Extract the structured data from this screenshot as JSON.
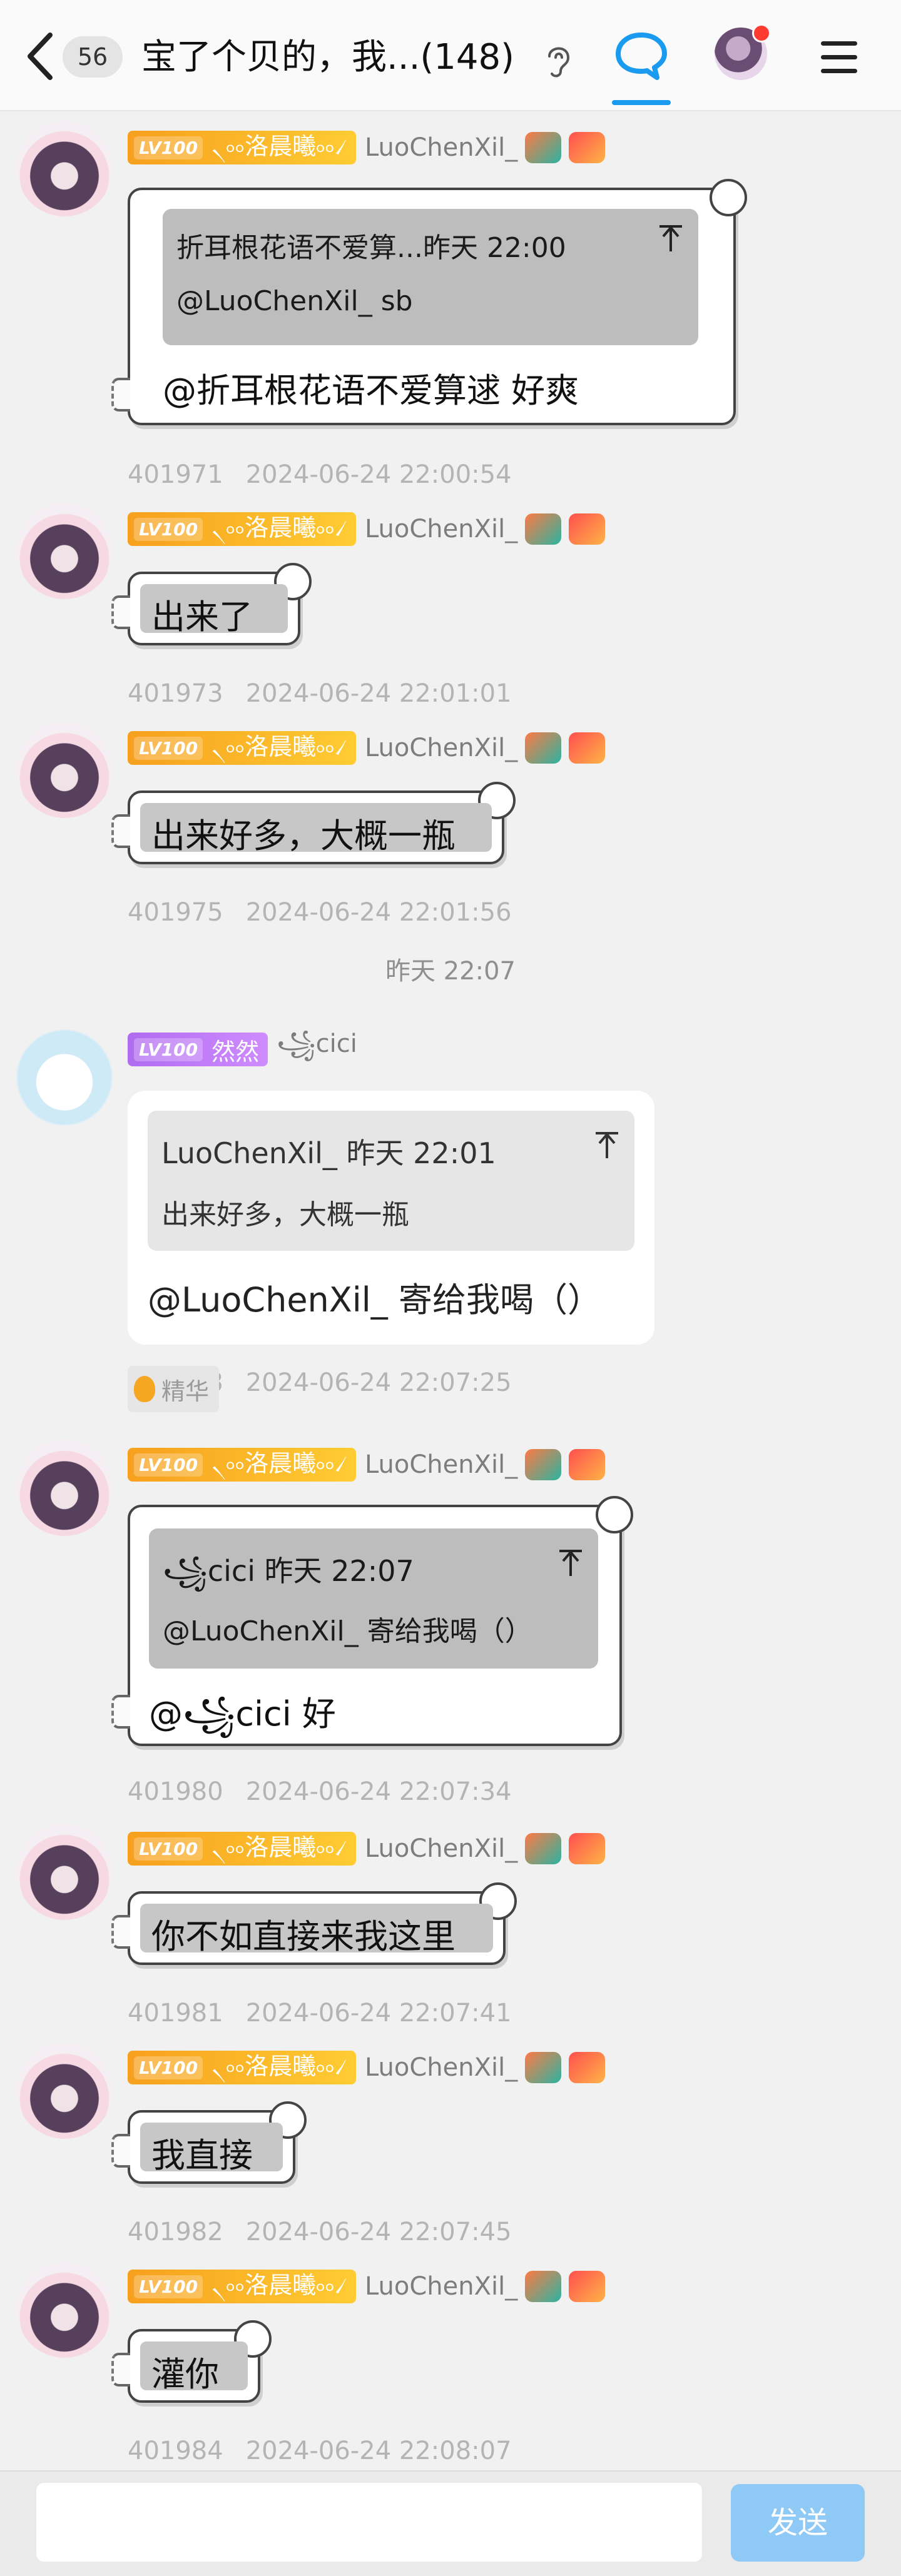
{
  "header": {
    "back_icon": "chevron-left-icon",
    "unread_count": "56",
    "title": "宝了个贝的，我...(148)",
    "ear_icon": "ear-icon",
    "chat_icon": "chat-bubble-icon",
    "menu_icon": "hamburger-menu-icon",
    "accent_color": "#1a9bf0",
    "notification_color": "#ff3b30"
  },
  "messages": [
    {
      "level": "LV100",
      "title": "৲৹৹洛晨曦৹৹৴",
      "username": "LuoChenXil_",
      "quote_author_time": "折耳根花语不爱算...昨天 22:00",
      "quote_text": "@LuoChenXil_ sb",
      "text": "@折耳根花语不爱算逑 好爽",
      "msg_id": "401971",
      "timestamp": "2024-06-24 22:00:54"
    },
    {
      "level": "LV100",
      "title": "৲৹৹洛晨曦৹৹৴",
      "username": "LuoChenXil_",
      "text": "出来了",
      "msg_id": "401973",
      "timestamp": "2024-06-24 22:01:01"
    },
    {
      "level": "LV100",
      "title": "৲৹৹洛晨曦৹৹৴",
      "username": "LuoChenXil_",
      "text": "出来好多，大概一瓶",
      "msg_id": "401975",
      "timestamp": "2024-06-24 22:01:56"
    },
    {
      "level": "LV100",
      "title": "然然",
      "username": "꧁cici",
      "quote_author_time": "LuoChenXil_ 昨天 22:01",
      "quote_text": "出来好多，大概一瓶",
      "text": "@LuoChenXil_ 寄给我喝（）",
      "msg_id": "401978",
      "timestamp": "2024-06-24 22:07:25",
      "essence_label": "精华"
    },
    {
      "level": "LV100",
      "title": "৲৹৹洛晨曦৹৹৴",
      "username": "LuoChenXil_",
      "quote_author_time": "꧁cici 昨天 22:07",
      "quote_text": "@LuoChenXil_ 寄给我喝（）",
      "text": "@꧁cici 好",
      "msg_id": "401980",
      "timestamp": "2024-06-24 22:07:34"
    },
    {
      "level": "LV100",
      "title": "৲৹৹洛晨曦৹৹৴",
      "username": "LuoChenXil_",
      "text": "你不如直接来我这里",
      "msg_id": "401981",
      "timestamp": "2024-06-24 22:07:41"
    },
    {
      "level": "LV100",
      "title": "৲৹৹洛晨曦৹৹৴",
      "username": "LuoChenXil_",
      "text": "我直接",
      "msg_id": "401982",
      "timestamp": "2024-06-24 22:07:45"
    },
    {
      "level": "LV100",
      "title": "৲৹৹洛晨曦৹৹৴",
      "username": "LuoChenXil_",
      "text": "灌你",
      "msg_id": "401984",
      "timestamp": "2024-06-24 22:08:07"
    }
  ],
  "time_divider": "昨天 22:07",
  "composer": {
    "input_value": "",
    "send_label": "发送",
    "send_color": "#8fc9f6"
  }
}
